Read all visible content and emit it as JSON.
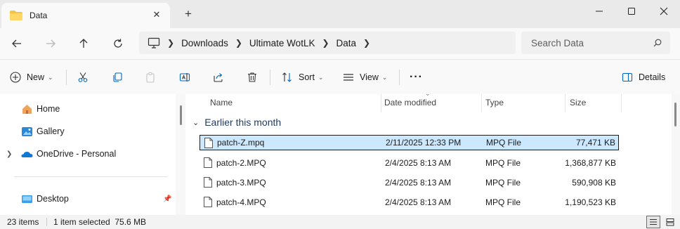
{
  "window": {
    "tab_title": "Data",
    "tab_close": "✕",
    "new_tab": "+"
  },
  "address": {
    "breadcrumb": [
      "Downloads",
      "Ultimate WotLK",
      "Data"
    ],
    "search_placeholder": "Search Data"
  },
  "commands": {
    "new_label": "New",
    "sort_label": "Sort",
    "view_label": "View",
    "more_label": "···",
    "details_label": "Details"
  },
  "sidebar": {
    "items": [
      {
        "label": "Home",
        "icon": "home-icon"
      },
      {
        "label": "Gallery",
        "icon": "gallery-icon"
      },
      {
        "label": "OneDrive - Personal",
        "icon": "onedrive-icon"
      },
      {
        "label": "Desktop",
        "icon": "desktop-icon"
      }
    ]
  },
  "columns": {
    "name": "Name",
    "date": "Date modified",
    "type": "Type",
    "size": "Size"
  },
  "group": {
    "label": "Earlier this month"
  },
  "files": [
    {
      "name": "patch-Z.mpq",
      "date": "2/11/2025 12:33 PM",
      "type": "MPQ File",
      "size": "77,471 KB",
      "selected": true
    },
    {
      "name": "patch-2.MPQ",
      "date": "2/4/2025 8:13 AM",
      "type": "MPQ File",
      "size": "1,368,877 KB",
      "selected": false
    },
    {
      "name": "patch-3.MPQ",
      "date": "2/4/2025 8:13 AM",
      "type": "MPQ File",
      "size": "590,908 KB",
      "selected": false
    },
    {
      "name": "patch-4.MPQ",
      "date": "2/4/2025 8:13 AM",
      "type": "MPQ File",
      "size": "1,190,523 KB",
      "selected": false
    }
  ],
  "status": {
    "item_count": "23 items",
    "selection": "1 item selected  75.6 MB"
  },
  "colors": {
    "accent": "#0067c0",
    "selection_bg": "#cce8ff",
    "folder": "#f6c445"
  }
}
